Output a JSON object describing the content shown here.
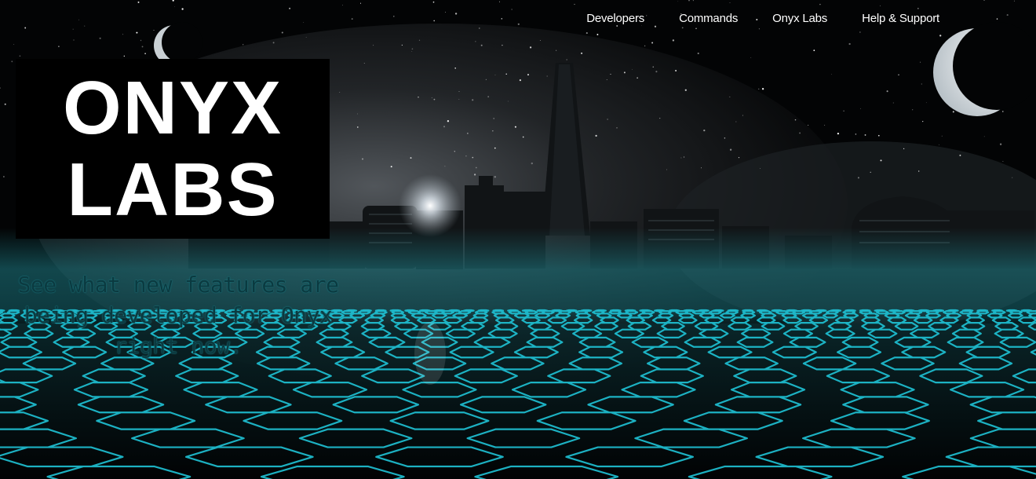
{
  "nav": {
    "items": [
      {
        "label": "Developers"
      },
      {
        "label": "Commands"
      },
      {
        "label": "Onyx Labs"
      },
      {
        "label": "Help & Support"
      }
    ]
  },
  "logo": {
    "line1": "ONYX",
    "line2": "LABS"
  },
  "hero": {
    "tagline": "See what new features are being developed for Onyx right now."
  },
  "colors": {
    "grid_accent": "#1fc3d6",
    "fog": "#1e7d86",
    "logo_bg": "#000000",
    "logo_text": "#ffffff",
    "tagline_text": "#0b3a40"
  }
}
